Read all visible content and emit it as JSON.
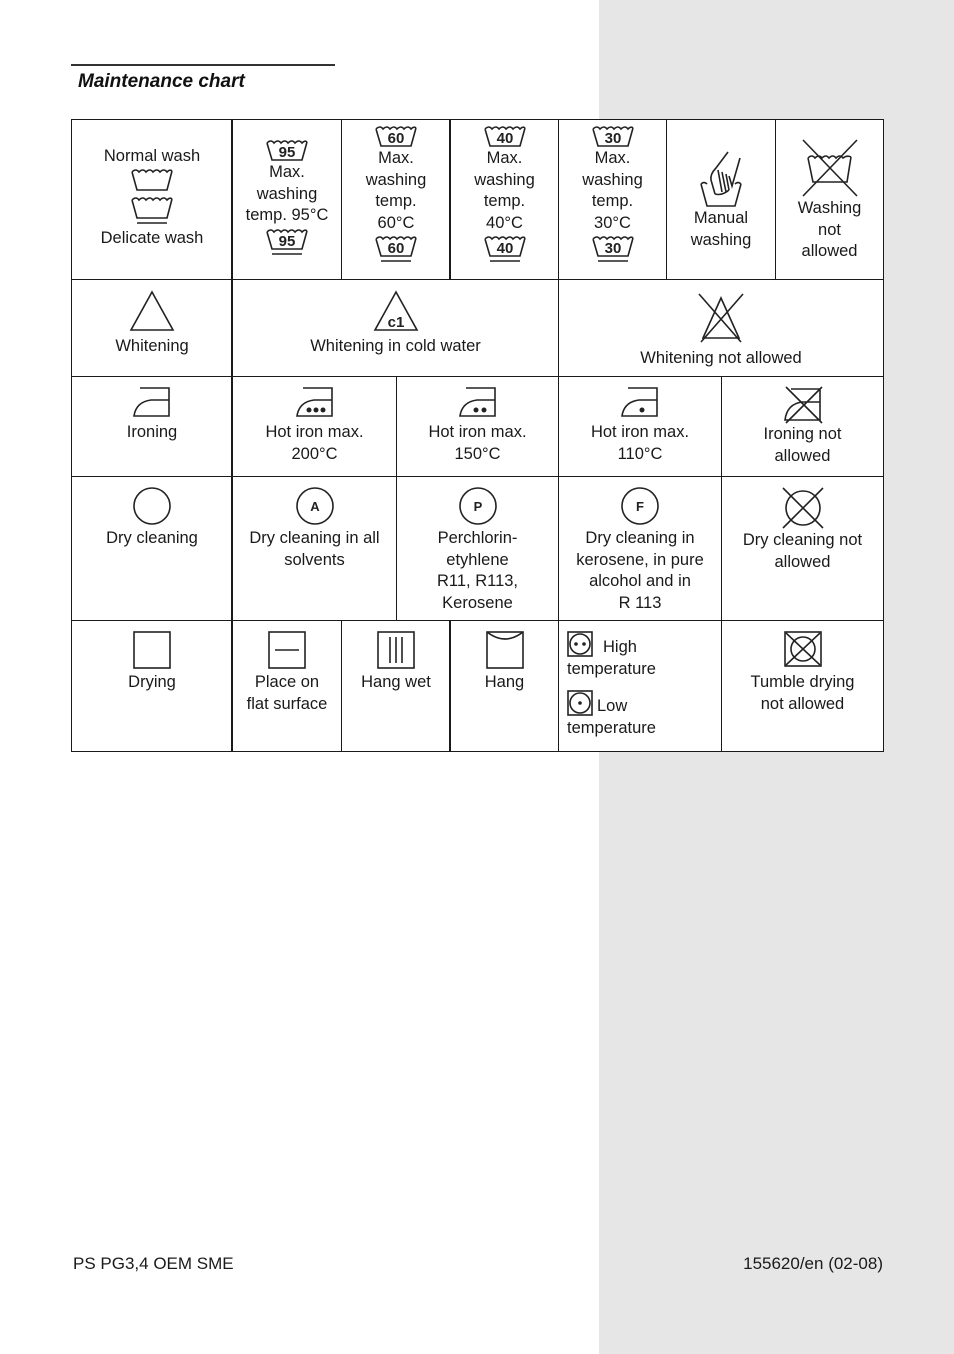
{
  "page": {
    "title": "Maintenance chart",
    "footer_left": "PS PG3,4  OEM  SME",
    "footer_right": "155620/en (02-08)",
    "band_color": "#e6e6e6"
  },
  "washing": {
    "normal_label": "Normal wash",
    "delicate_label": "Delicate wash",
    "max95": {
      "number": "95",
      "label": "Max.\nwashing\ntemp. 95°C"
    },
    "max60": {
      "number": "60",
      "label": "Max.\nwashing\ntemp.\n60°C"
    },
    "max40": {
      "number": "40",
      "label": "Max.\nwashing\ntemp.\n40°C"
    },
    "max30": {
      "number": "30",
      "label": "Max.\nwashing\ntemp.\n30°C"
    },
    "manual_label": "Manual\nwashing",
    "not_allowed_label": "Washing\nnot\nallowed"
  },
  "whitening": {
    "allowed_label": "Whitening",
    "cold_symbol": "c1",
    "cold_label": "Whitening in cold water",
    "not_allowed_label": "Whitening not allowed"
  },
  "ironing": {
    "allowed_label": "Ironing",
    "hot200_label": "Hot iron max.\n200°C",
    "hot150_label": "Hot iron max.\n150°C",
    "hot110_label": "Hot iron max.\n110°C",
    "not_allowed_label": "Ironing not\nallowed"
  },
  "dry_cleaning": {
    "allowed_label": "Dry cleaning",
    "a_symbol": "A",
    "a_label": "Dry cleaning in all\nsolvents",
    "p_symbol": "P",
    "p_label": "Perchlorin-\netyhlene\nR11, R113,\nKerosene",
    "f_symbol": "F",
    "f_label": "Dry cleaning in\nkerosene, in pure\nalcohol and in\nR 113",
    "not_allowed_label": "Dry cleaning not\nallowed"
  },
  "drying": {
    "allowed_label": "Drying",
    "flat_label": "Place on\nflat surface",
    "hang_wet_label": "Hang wet",
    "hang_label": "Hang",
    "high_label": "High",
    "high_label2": "temperature",
    "low_label": "Low",
    "low_label2": "temperature",
    "tumble_not_allowed_label": "Tumble drying\nnot allowed"
  }
}
